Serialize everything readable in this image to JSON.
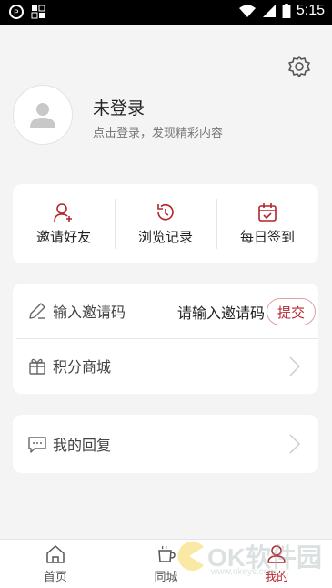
{
  "status_bar": {
    "time": "5:15",
    "icons": [
      "app-p-icon",
      "screen-grid-icon",
      "wifi-icon",
      "signal-icon",
      "battery-icon"
    ]
  },
  "settings": {
    "icon": "gear-icon"
  },
  "profile": {
    "name": "未登录",
    "subtitle": "点击登录，发现精彩内容",
    "avatar_icon": "user-placeholder-icon"
  },
  "quick_actions": [
    {
      "label": "邀请好友",
      "icon": "add-user-icon"
    },
    {
      "label": "浏览记录",
      "icon": "history-icon"
    },
    {
      "label": "每日签到",
      "icon": "calendar-check-icon"
    }
  ],
  "list": {
    "invite": {
      "label": "输入邀请码",
      "icon": "pencil-icon",
      "placeholder": "请输入邀请码",
      "submit": "提交"
    },
    "shop": {
      "label": "积分商城",
      "icon": "gift-icon"
    }
  },
  "reply": {
    "label": "我的回复",
    "icon": "comment-icon"
  },
  "bottom_nav": [
    {
      "label": "首页",
      "icon": "home-icon",
      "active": false
    },
    {
      "label": "同城",
      "icon": "cup-icon",
      "active": false
    },
    {
      "label": "我的",
      "icon": "person-icon",
      "active": true
    }
  ],
  "watermark": {
    "text": "OK软件园",
    "url": "www.okeys.com"
  },
  "colors": {
    "accent": "#b3262d",
    "background": "#f4f4f4",
    "card": "#ffffff"
  }
}
